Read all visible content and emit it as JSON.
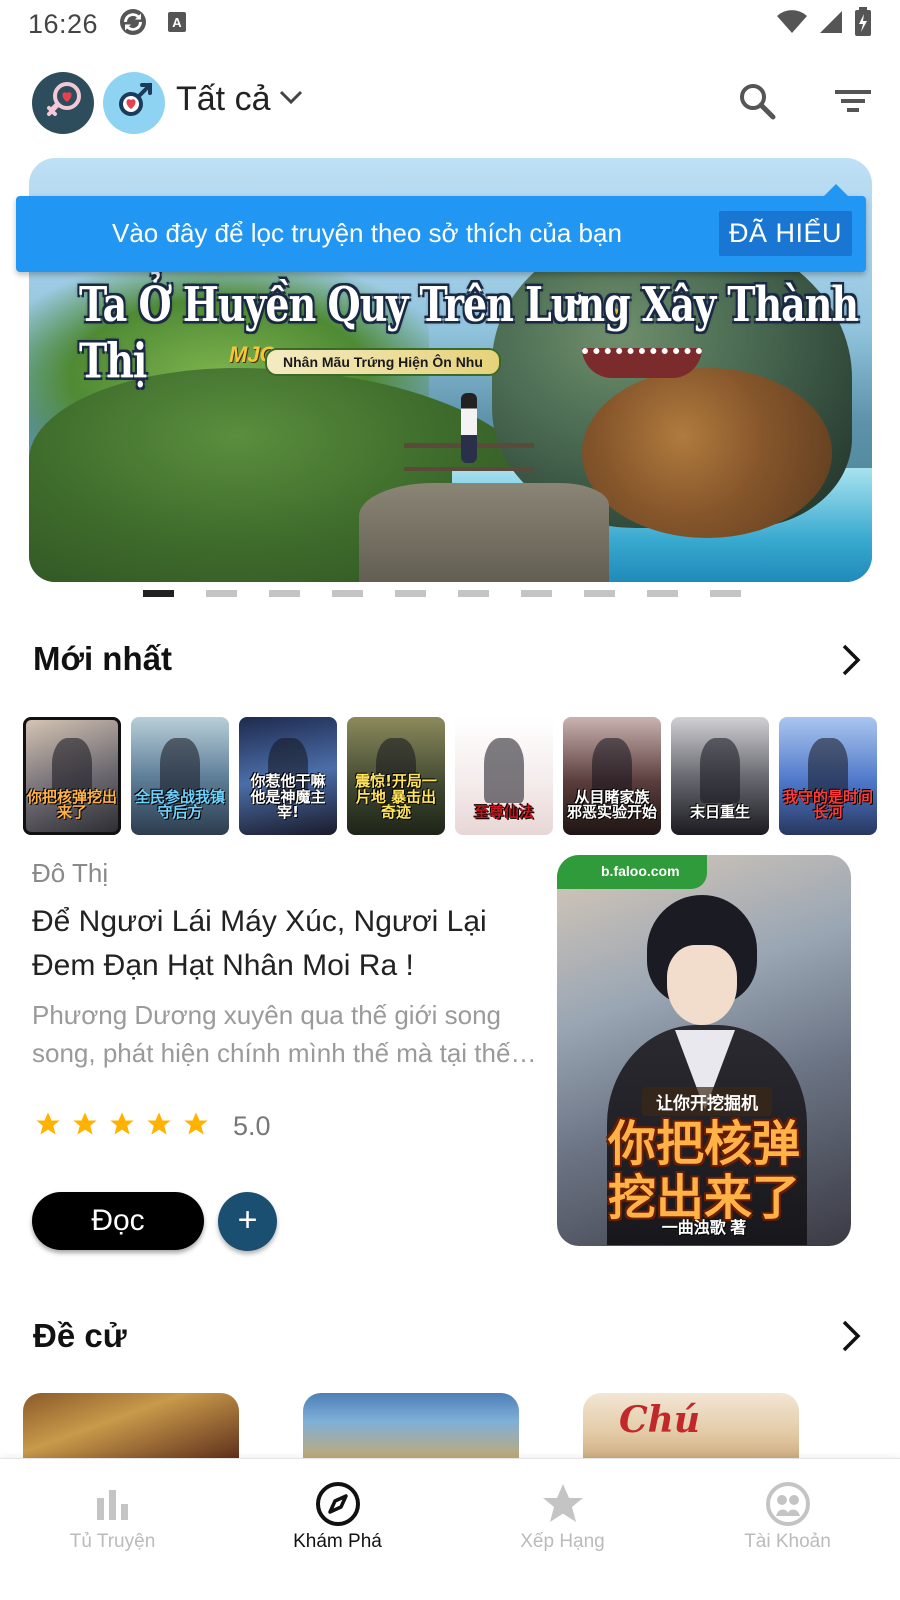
{
  "status_bar": {
    "time": "16:26"
  },
  "header": {
    "filter_label": "Tất cả"
  },
  "banner": {
    "title": "Ta Ở Huyền Quy Trên Lưng Xây Thành Thị",
    "author_tag": "Nhân Mãu Trứng Hiện Ôn Nhu",
    "logo_text": "MJC",
    "page_count": 10,
    "active_page": 0
  },
  "tooltip": {
    "message": "Vào đây để lọc truyện theo sở thích của bạn",
    "button_label": "ĐÃ HIỂU"
  },
  "latest": {
    "section_title": "Mới nhất",
    "thumbnails": [
      {
        "title": "你把核弹挖出来了",
        "bg": "linear-gradient(160deg,#d9c8b6,#6e6a72 55%,#2a2a30)",
        "fg": "#ffb347"
      },
      {
        "title": "全民参战我镇守后方",
        "bg": "linear-gradient(180deg,#b9cfd8,#60809a 50%,#2c3c4e)",
        "fg": "#6fd3ff"
      },
      {
        "title": "你惹他干嘛 他是神魔主宰!",
        "bg": "linear-gradient(170deg,#1e2a4e,#4b6ea8 50%,#1a1a2a)",
        "fg": "#ffffff"
      },
      {
        "title": "震惊!开局一片地 暴击出奇迹",
        "bg": "linear-gradient(180deg,#8c8a5c,#3e4630 60%,#1d2418)",
        "fg": "#ffe45c"
      },
      {
        "title": "至尊仙法",
        "bg": "linear-gradient(180deg,#ffffff,#f4eaea 60%,#e8d6d6)",
        "fg": "#c8161e"
      },
      {
        "title": "从目睹家族 邪恶实验开始",
        "bg": "linear-gradient(180deg,#c9b3b0,#5a3c3c 55%,#1e1414)",
        "fg": "#ffffff"
      },
      {
        "title": "末日重生",
        "bg": "linear-gradient(180deg,#d0d0d4,#6a6a72 50%,#1a1a20)",
        "fg": "#ffffff"
      },
      {
        "title": "我守的是时间长河",
        "bg": "linear-gradient(180deg,#aac6ef,#4e77c8 55%,#27375e)",
        "fg": "#ff3b3b"
      }
    ],
    "featured": {
      "genre": "Đô Thị",
      "title": "Để Ngươi Lái Máy Xúc, Ngươi Lại Đem Đạn Hạt Nhân Moi Ra !",
      "description": "Phương Dương xuyên qua thế giới song song, phát hiện chính mình thế mà tại thế giới này...",
      "rating_value": 5.0,
      "rating_text": "5.0",
      "read_label": "Đọc",
      "add_label": "+",
      "cover": {
        "badge": "b.faloo.com",
        "subtitle": "让你开挖掘机",
        "title_line1": "你把核弹",
        "title_line2": "挖出来了",
        "author": "一曲浊歌 著"
      }
    }
  },
  "recommended": {
    "section_title": "Đề cử",
    "cards": [
      {
        "bg": "linear-gradient(160deg,#8a5a2a,#c89a4a 40%,#5a2a1a)",
        "text": ""
      },
      {
        "bg": "linear-gradient(180deg,#4e7fb8,#7fb0d8 40%,#c8a86a)",
        "text": ""
      },
      {
        "bg": "linear-gradient(180deg,#f2e6d4,#e2c9a4 60%,#c7a67a)",
        "text": "Chú"
      }
    ]
  },
  "bottom_nav": {
    "items": [
      {
        "label": "Tủ Truyện",
        "icon": "bar-chart-icon",
        "active": false
      },
      {
        "label": "Khám Phá",
        "icon": "compass-icon",
        "active": true
      },
      {
        "label": "Xếp Hạng",
        "icon": "star-icon",
        "active": false
      },
      {
        "label": "Tài Khoản",
        "icon": "account-icon",
        "active": false
      }
    ]
  },
  "colors": {
    "tooltip_bg": "#2196f3",
    "tooltip_button": "#1976d2",
    "add_button": "#1b4f72",
    "star": "#ffb300"
  }
}
